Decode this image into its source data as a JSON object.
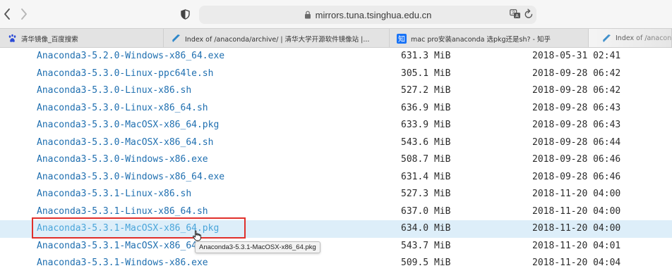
{
  "browser": {
    "url": "mirrors.tuna.tsinghua.edu.cn",
    "tabs": [
      {
        "title": "清华镜像_百度搜索",
        "favicon": "baidu-paw-icon",
        "active": false
      },
      {
        "title": "Index of /anaconda/archive/ | 清华大学开源软件镜像站 |...",
        "favicon": "tuna-icon",
        "active": false
      },
      {
        "title": "mac pro安装anaconda 选pkg还是sh? - 知乎",
        "favicon": "zhihu-icon",
        "active": false
      },
      {
        "title": "Index of /anaconda/archi",
        "favicon": "tuna-icon",
        "active": true
      }
    ]
  },
  "files": [
    {
      "name": "Anaconda3-5.2.0-Windows-x86_64.exe",
      "size": "631.3 MiB",
      "date": "2018-05-31 02:41"
    },
    {
      "name": "Anaconda3-5.3.0-Linux-ppc64le.sh",
      "size": "305.1 MiB",
      "date": "2018-09-28 06:42"
    },
    {
      "name": "Anaconda3-5.3.0-Linux-x86.sh",
      "size": "527.2 MiB",
      "date": "2018-09-28 06:42"
    },
    {
      "name": "Anaconda3-5.3.0-Linux-x86_64.sh",
      "size": "636.9 MiB",
      "date": "2018-09-28 06:43"
    },
    {
      "name": "Anaconda3-5.3.0-MacOSX-x86_64.pkg",
      "size": "633.9 MiB",
      "date": "2018-09-28 06:43"
    },
    {
      "name": "Anaconda3-5.3.0-MacOSX-x86_64.sh",
      "size": "543.6 MiB",
      "date": "2018-09-28 06:44"
    },
    {
      "name": "Anaconda3-5.3.0-Windows-x86.exe",
      "size": "508.7 MiB",
      "date": "2018-09-28 06:46"
    },
    {
      "name": "Anaconda3-5.3.0-Windows-x86_64.exe",
      "size": "631.4 MiB",
      "date": "2018-09-28 06:46"
    },
    {
      "name": "Anaconda3-5.3.1-Linux-x86.sh",
      "size": "527.3 MiB",
      "date": "2018-11-20 04:00"
    },
    {
      "name": "Anaconda3-5.3.1-Linux-x86_64.sh",
      "size": "637.0 MiB",
      "date": "2018-11-20 04:00"
    },
    {
      "name": "Anaconda3-5.3.1-MacOSX-x86_64.pkg",
      "size": "634.0 MiB",
      "date": "2018-11-20 04:00",
      "hovered": true
    },
    {
      "name": "Anaconda3-5.3.1-MacOSX-x86_64.sh",
      "size": "543.7 MiB",
      "date": "2018-11-20 04:01"
    },
    {
      "name": "Anaconda3-5.3.1-Windows-x86.exe",
      "size": "509.5 MiB",
      "date": "2018-11-20 04:04"
    }
  ],
  "tooltip": "Anaconda3-5.3.1-MacOSX-x86_64.pkg",
  "colors": {
    "link": "#1f6fb0",
    "link_hover": "#4aa5da",
    "row_hover_bg": "#ddeef9",
    "highlight_border": "#e0302b"
  }
}
